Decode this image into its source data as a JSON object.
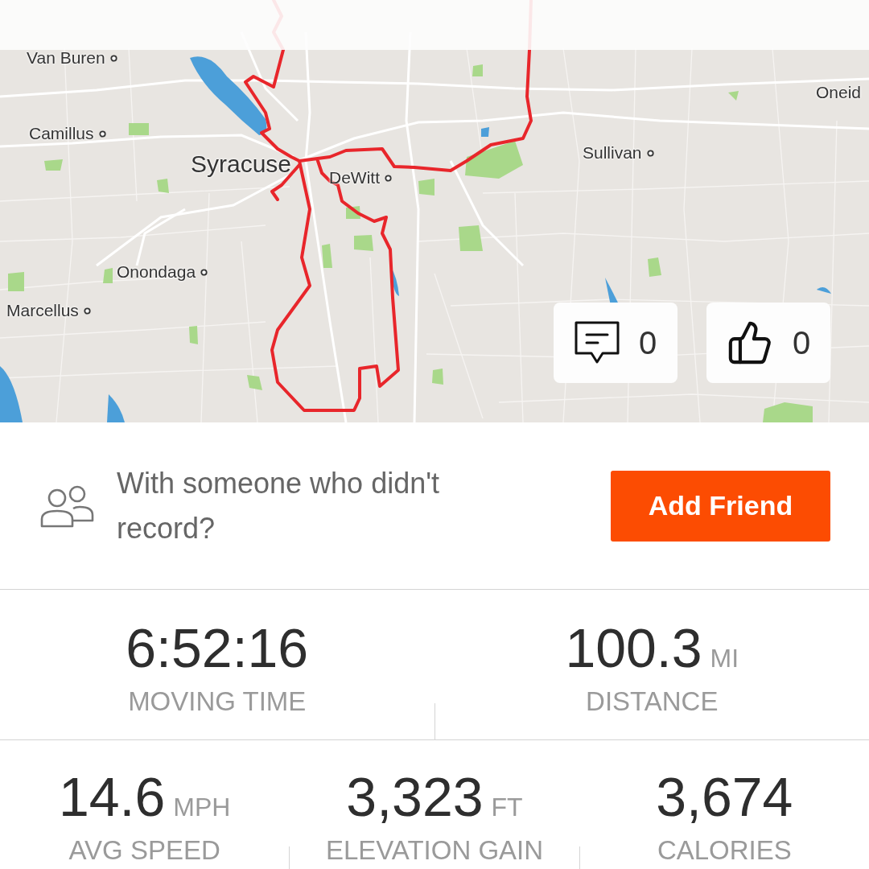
{
  "map": {
    "places": [
      {
        "name": "Van Buren",
        "kind": "town",
        "dot": true
      },
      {
        "name": "Oneid",
        "kind": "town",
        "dot": false
      },
      {
        "name": "Camillus",
        "kind": "town",
        "dot": true
      },
      {
        "name": "Sullivan",
        "kind": "town",
        "dot": true
      },
      {
        "name": "Syracuse",
        "kind": "city",
        "dot": false
      },
      {
        "name": "DeWitt",
        "kind": "town",
        "dot": true
      },
      {
        "name": "Onondaga",
        "kind": "town",
        "dot": true
      },
      {
        "name": "Marcellus",
        "kind": "town",
        "dot": true
      }
    ],
    "reactions": [
      {
        "kind": "comment",
        "count": "0"
      },
      {
        "kind": "like",
        "count": "0"
      }
    ]
  },
  "invite": {
    "text": "With someone who didn't record?",
    "button": "Add Friend"
  },
  "stat_rows": [
    {
      "stats": [
        {
          "value": "6:52:16",
          "label": "MOVING TIME"
        },
        {
          "value": "100.3",
          "unit": "MI",
          "label": "DISTANCE"
        }
      ]
    },
    {
      "stats": [
        {
          "value": "14.6",
          "unit": "MPH",
          "label": "AVG SPEED"
        },
        {
          "value": "3,323",
          "unit": "FT",
          "label": "ELEVATION GAIN"
        },
        {
          "value": "3,674",
          "label": "CALORIES"
        }
      ]
    }
  ]
}
